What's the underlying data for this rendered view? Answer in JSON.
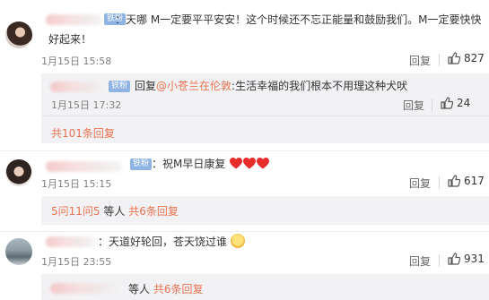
{
  "comments": [
    {
      "text_line1": "：天哪 M一定要平平安安！这个时候还不忘正能量和鼓励我们。M一定要快快",
      "text_line2": "好起来！",
      "time": "1月15日 15:58",
      "reply_label": "回复",
      "likes": "827",
      "sub_reply": {
        "prefix": "回复",
        "mention": "@小苍兰在伦敦",
        "text": ":生活幸福的我们根本不用理这种犬吠",
        "time": "1月15日 17:32",
        "reply_label": "回复",
        "likes": "24"
      },
      "more_replies": "共101条回复"
    },
    {
      "text": "：祝M早日康复",
      "time": "1月15日 15:15",
      "reply_label": "回复",
      "likes": "617",
      "sub_summary": {
        "names": "5问11问5",
        "mid": " 等人 ",
        "count": "共6条回复"
      }
    },
    {
      "text": "：天道好轮回，苍天饶过谁",
      "time": "1月15日 23:55",
      "reply_label": "回复",
      "likes": "931",
      "sub_summary": {
        "mid": "等人 ",
        "count": "共6条回复"
      }
    }
  ],
  "badge_label": "铁粉",
  "colors": {
    "link": "#eb7350",
    "badge": "#8fb3e3",
    "subbox": "#f2f2f5"
  }
}
